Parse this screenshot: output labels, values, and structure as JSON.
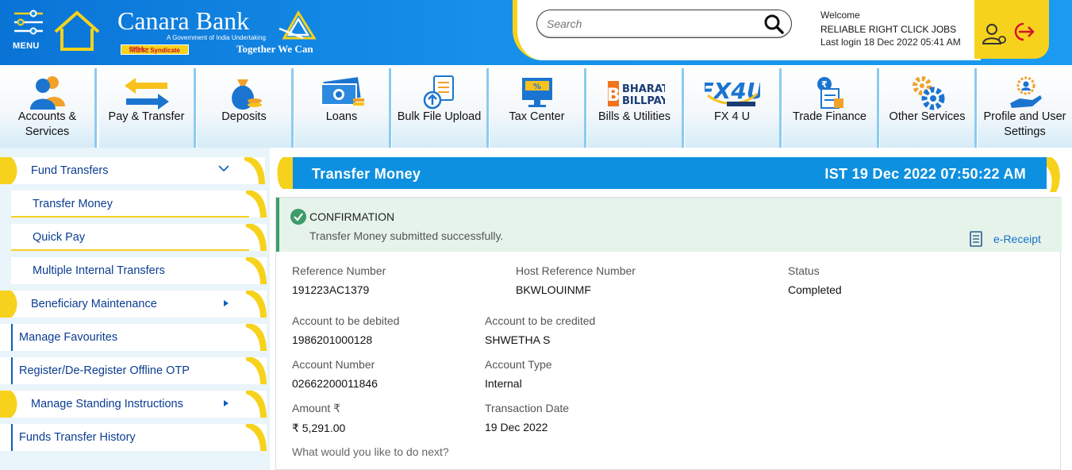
{
  "header": {
    "menu_label": "MENU",
    "bank_name": "Canara Bank",
    "bank_sub": "A Government of India Undertaking",
    "syndicate": "सिंडिकेट Syndicate",
    "tagline": "Together We Can",
    "search_placeholder": "Search",
    "welcome": "Welcome",
    "user_name": "RELIABLE RIGHT CLICK JOBS",
    "last_login": "Last login 18 Dec 2022 05:41 AM"
  },
  "nav": [
    {
      "label": "Accounts &",
      "label2": "Services",
      "icon": "users-icon"
    },
    {
      "label": "Pay & Transfer",
      "label2": "",
      "icon": "transfer-arrows-icon"
    },
    {
      "label": "Deposits",
      "label2": "",
      "icon": "money-bag-icon"
    },
    {
      "label": "Loans",
      "label2": "",
      "icon": "banknote-icon"
    },
    {
      "label": "Bulk File Upload",
      "label2": "",
      "icon": "file-upload-icon"
    },
    {
      "label": "Tax Center",
      "label2": "",
      "icon": "monitor-percent-icon"
    },
    {
      "label": "Bills & Utilities",
      "label2": "",
      "icon": "bharat-billpay-logo"
    },
    {
      "label": "FX 4 U",
      "label2": "",
      "icon": "fx4u-logo"
    },
    {
      "label": "Trade Finance",
      "label2": "",
      "icon": "trade-finance-icon"
    },
    {
      "label": "Other Services",
      "label2": "",
      "icon": "gears-icon"
    },
    {
      "label": "Profile and User",
      "label2": "Settings",
      "icon": "profile-hand-icon"
    }
  ],
  "sidebar": {
    "fund_transfers": "Fund Transfers",
    "transfer_money": "Transfer Money",
    "quick_pay": "Quick Pay",
    "multiple_internal": "Multiple Internal Transfers",
    "beneficiary": "Beneficiary Maintenance",
    "manage_fav": "Manage Favourites",
    "offline_otp": "Register/De-Register Offline OTP",
    "standing": "Manage Standing Instructions",
    "history": "Funds Transfer History"
  },
  "main": {
    "title": "Transfer Money",
    "datetime": "IST 19 Dec 2022 07:50:22 AM",
    "confirm_heading": "CONFIRMATION",
    "confirm_msg": "Transfer Money submitted successfully.",
    "ereceipt": "e-Receipt",
    "fields": {
      "ref_label": "Reference Number",
      "ref_value": "191223AC1379",
      "host_label": "Host Reference Number",
      "host_value": "BKWLOUINMF",
      "status_label": "Status",
      "status_value": "Completed",
      "debit_label": "Account to be debited",
      "debit_value": "1986201000128",
      "credit_label": "Account to be credited",
      "credit_value": "SHWETHA S",
      "accno_label": "Account Number",
      "accno_value": "02662200011846",
      "acctype_label": "Account Type",
      "acctype_value": "Internal",
      "amount_label": "Amount ₹",
      "amount_value": "₹ 5,291.00",
      "txdate_label": "Transaction Date",
      "txdate_value": "19 Dec 2022"
    },
    "next_question": "What would you like to do next?"
  },
  "colors": {
    "brand_blue": "#0e90e0",
    "accent_yellow": "#f7d21c",
    "nav_text": "#111111",
    "sidebar_text": "#0b3d91",
    "success_green": "#3e9b6a"
  }
}
